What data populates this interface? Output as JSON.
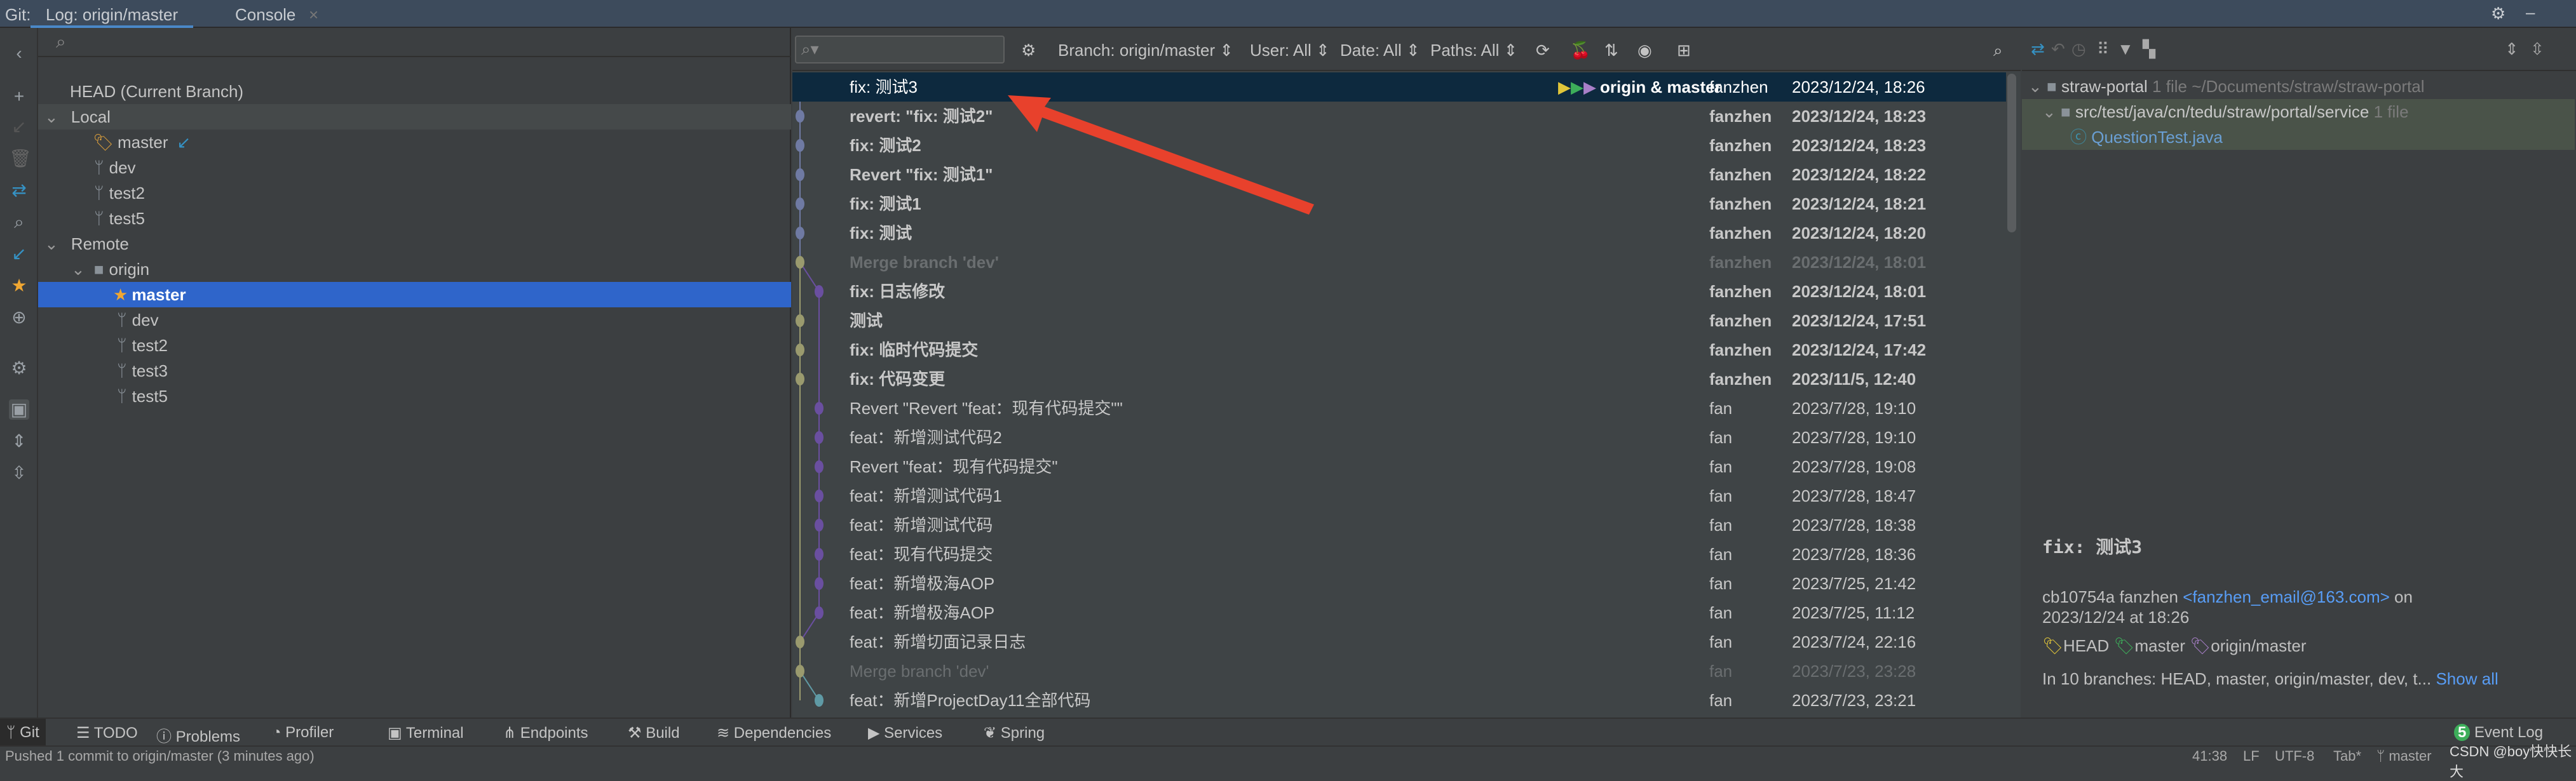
{
  "tabs": {
    "prefix": "Git:",
    "log": "Log: origin/master",
    "console": "Console",
    "close": "×"
  },
  "branches": {
    "head": "HEAD (Current Branch)",
    "local_label": "Local",
    "local": [
      "master",
      "dev",
      "test2",
      "test5"
    ],
    "remote_label": "Remote",
    "origin": "origin",
    "remote": [
      "master",
      "dev",
      "test2",
      "test3",
      "test5"
    ]
  },
  "log_toolbar": {
    "branch": "Branch: origin/master ⇕",
    "user": "User: All ⇕",
    "date": "Date: All ⇕",
    "paths": "Paths: All ⇕"
  },
  "commits": [
    {
      "msg": "fix: 测试3",
      "tag": "origin & master",
      "author": "fanzhen",
      "date": "2023/12/24, 18:26",
      "lane": 0,
      "color": "#6f7aa3",
      "style": "sel"
    },
    {
      "msg": "revert: \"fix: 测试2\"",
      "author": "fanzhen",
      "date": "2023/12/24, 18:23",
      "lane": 0,
      "color": "#6f7aa3",
      "style": "bold"
    },
    {
      "msg": "fix: 测试2",
      "author": "fanzhen",
      "date": "2023/12/24, 18:23",
      "lane": 0,
      "color": "#6f7aa3",
      "style": "bold"
    },
    {
      "msg": "Revert \"fix: 测试1\"",
      "author": "fanzhen",
      "date": "2023/12/24, 18:22",
      "lane": 0,
      "color": "#6f7aa3",
      "style": "bold"
    },
    {
      "msg": "fix: 测试1",
      "author": "fanzhen",
      "date": "2023/12/24, 18:21",
      "lane": 0,
      "color": "#6f7aa3",
      "style": "bold"
    },
    {
      "msg": "fix: 测试",
      "author": "fanzhen",
      "date": "2023/12/24, 18:20",
      "lane": 0,
      "color": "#6f7aa3",
      "style": "bold"
    },
    {
      "msg": "Merge branch 'dev'",
      "author": "fanzhen",
      "date": "2023/12/24, 18:01",
      "lane": 0,
      "color": "#9a9a6e",
      "style": "dim bold"
    },
    {
      "msg": "fix: 日志修改",
      "author": "fanzhen",
      "date": "2023/12/24, 18:01",
      "lane": 1,
      "color": "#6a4fa0",
      "style": "bold"
    },
    {
      "msg": "测试",
      "author": "fanzhen",
      "date": "2023/12/24, 17:51",
      "lane": 0,
      "color": "#9a9a6e",
      "style": "bold"
    },
    {
      "msg": "fix: 临时代码提交",
      "author": "fanzhen",
      "date": "2023/12/24, 17:42",
      "lane": 0,
      "color": "#9a9a6e",
      "style": "bold"
    },
    {
      "msg": "fix: 代码变更",
      "author": "fanzhen",
      "date": "2023/11/5, 12:40",
      "lane": 0,
      "color": "#9a9a6e",
      "style": "bold"
    },
    {
      "msg": "Revert \"Revert \"feat：现有代码提交\"\"",
      "author": "fan",
      "date": "2023/7/28, 19:10",
      "lane": 1,
      "color": "#6a4fa0",
      "style": ""
    },
    {
      "msg": "feat：新增测试代码2",
      "author": "fan",
      "date": "2023/7/28, 19:10",
      "lane": 1,
      "color": "#6a4fa0",
      "style": ""
    },
    {
      "msg": "Revert \"feat：现有代码提交\"",
      "author": "fan",
      "date": "2023/7/28, 19:08",
      "lane": 1,
      "color": "#6a4fa0",
      "style": ""
    },
    {
      "msg": "feat：新增测试代码1",
      "author": "fan",
      "date": "2023/7/28, 18:47",
      "lane": 1,
      "color": "#6a4fa0",
      "style": ""
    },
    {
      "msg": "feat：新增测试代码",
      "author": "fan",
      "date": "2023/7/28, 18:38",
      "lane": 1,
      "color": "#6a4fa0",
      "style": ""
    },
    {
      "msg": "feat：现有代码提交",
      "author": "fan",
      "date": "2023/7/28, 18:36",
      "lane": 1,
      "color": "#6a4fa0",
      "style": ""
    },
    {
      "msg": "feat：新增极海AOP",
      "author": "fan",
      "date": "2023/7/25, 21:42",
      "lane": 1,
      "color": "#6a4fa0",
      "style": ""
    },
    {
      "msg": "feat：新增极海AOP",
      "author": "fan",
      "date": "2023/7/25, 11:12",
      "lane": 1,
      "color": "#6a4fa0",
      "style": ""
    },
    {
      "msg": "feat：新增切面记录日志",
      "author": "fan",
      "date": "2023/7/24, 22:16",
      "lane": 0,
      "color": "#9a9a6e",
      "style": ""
    },
    {
      "msg": "Merge branch 'dev'",
      "author": "fan",
      "date": "2023/7/23, 23:28",
      "lane": 0,
      "color": "#9a9a6e",
      "style": "dim"
    },
    {
      "msg": "feat：新增ProjectDay11全部代码",
      "author": "fan",
      "date": "2023/7/23, 23:21",
      "lane": 1,
      "color": "#5f9aa5",
      "style": ""
    }
  ],
  "changes": {
    "root": "straw-portal",
    "root_count": "1 file",
    "root_path": "~/Documents/straw/straw-portal",
    "dir": "src/test/java/cn/tedu/straw/portal/service",
    "dir_count": "1 file",
    "file": "QuestionTest.java"
  },
  "details": {
    "subject": "fix: 测试3",
    "hash_author": "cb10754a fanzhen",
    "email": "<fanzhen_email@163.com>",
    "on": "on",
    "date": "2023/12/24 at 18:26",
    "refs": [
      {
        "name": "HEAD",
        "color": "#e0c53a"
      },
      {
        "name": "master",
        "color": "#3dae5a"
      },
      {
        "name": "origin/master",
        "color": "#a87fc8"
      }
    ],
    "branches": "In 10 branches: HEAD, master, origin/master, dev, t...",
    "show_all": "Show all"
  },
  "bottom_tools": [
    "Git",
    "TODO",
    "Problems",
    "Profiler",
    "Terminal",
    "Endpoints",
    "Build",
    "Dependencies",
    "Services",
    "Spring"
  ],
  "event_log": {
    "count": "5",
    "label": "Event Log"
  },
  "status": {
    "message": "Pushed 1 commit to origin/master (3 minutes ago)",
    "position": "41:38",
    "line_sep": "LF",
    "encoding": "UTF-8",
    "indent": "Tab*",
    "branch": "master",
    "watermark": "CSDN @boy快快长大"
  },
  "colors": {
    "selection": "#2f65ca",
    "row_selected": "#0d293e",
    "annotation_arrow": "#e8412c"
  }
}
